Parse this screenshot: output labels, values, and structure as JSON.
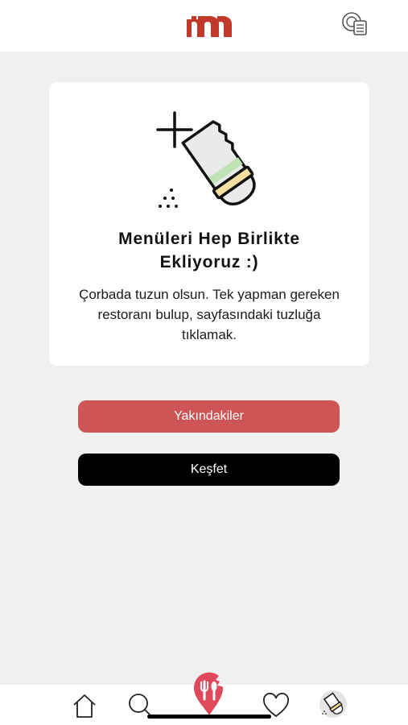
{
  "header": {
    "logo_icon": "m-logo-icon",
    "menu_icon": "restaurant-menu-icon"
  },
  "card": {
    "illustration_icon": "salt-shaker-add-icon",
    "title_line1": "Menüleri Hep Birlikte",
    "title_line2": "Ekliyoruz :)",
    "body_line1": "Çorbada tuzun olsun. Tek yapman gereken",
    "body_line2": "restoranı bulup, sayfasındaki tuzluğa",
    "body_line3": "tıklamak."
  },
  "buttons": {
    "nearby_label": "Yakındakiler",
    "explore_label": "Keşfet"
  },
  "tabbar": {
    "tabs": [
      "home-icon",
      "search-icon",
      "map-pin-cutlery-icon",
      "heart-icon",
      "salt-shaker-icon"
    ]
  },
  "colors": {
    "brand_red": "#c0392b",
    "nearby_button": "#cd5555",
    "explore_button": "#000000",
    "background": "#f0f0f0",
    "card": "#ffffff"
  }
}
